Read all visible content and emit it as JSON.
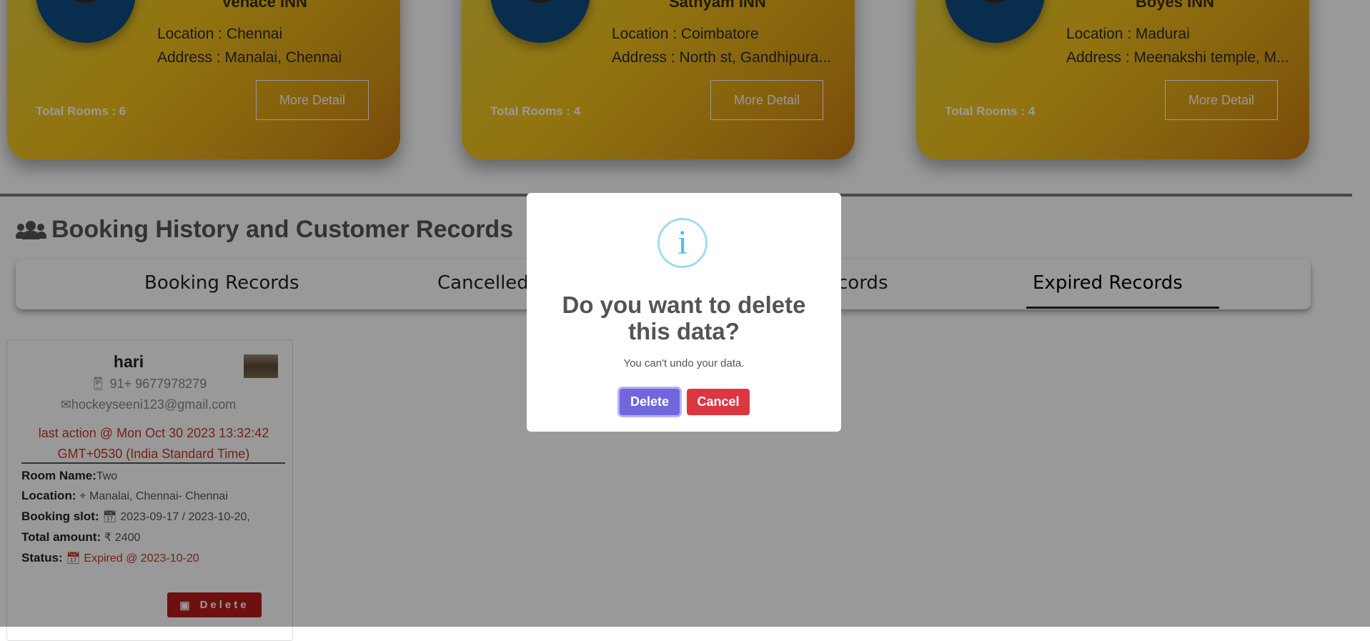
{
  "hotels": [
    {
      "name": "Venace INN",
      "location": "Location : Chennai",
      "address": "Address : Manalai, Chennai",
      "rooms": "Total Rooms : 6",
      "more": "More Detail"
    },
    {
      "name": "Sathyam INN",
      "location": "Location : Coimbatore",
      "address": "Address : North st, Gandhipura...",
      "rooms": "Total Rooms : 4",
      "more": "More Detail"
    },
    {
      "name": "Boyes INN",
      "location": "Location : Madurai",
      "address": "Address : Meenakshi temple, M...",
      "rooms": "Total Rooms : 4",
      "more": "More Detail"
    }
  ],
  "section": {
    "title": "Booking History and Customer Records",
    "icon": "users-icon"
  },
  "tabs": [
    "Booking Records",
    "Cancelled",
    "cords",
    "Expired Records"
  ],
  "active_tab": "Expired Records",
  "record": {
    "name": "hari",
    "phone": "91+ 9677978279",
    "email": "hockeyseeni123@gmail.com",
    "last_action_1": "last action @ Mon Oct 30 2023 13:32:42",
    "last_action_2": "GMT+0530 (India Standard Time)",
    "room_label": "Room Name:",
    "room_value": "Two",
    "location_label": "Location:",
    "location_value": "Manalai, Chennai- Chennai",
    "slot_label": "Booking slot:",
    "slot_value": "2023-09-17 / 2023-10-20,",
    "amount_label": "Total amount:",
    "amount_currency": "₹",
    "amount_value": "2400",
    "status_label": "Status:",
    "status_value": "Expired @ 2023-10-20",
    "delete_label": "Delete"
  },
  "modal": {
    "icon": "i",
    "title": "Do you want to delete this data?",
    "text": "You can't undo your data.",
    "confirm": "Delete",
    "cancel": "Cancel"
  },
  "colors": {
    "card_gold": "#f2c21a",
    "confirm": "#7066e0",
    "cancel": "#dc3741",
    "status_red": "#c0392b",
    "delete_red": "#b71c1c"
  }
}
